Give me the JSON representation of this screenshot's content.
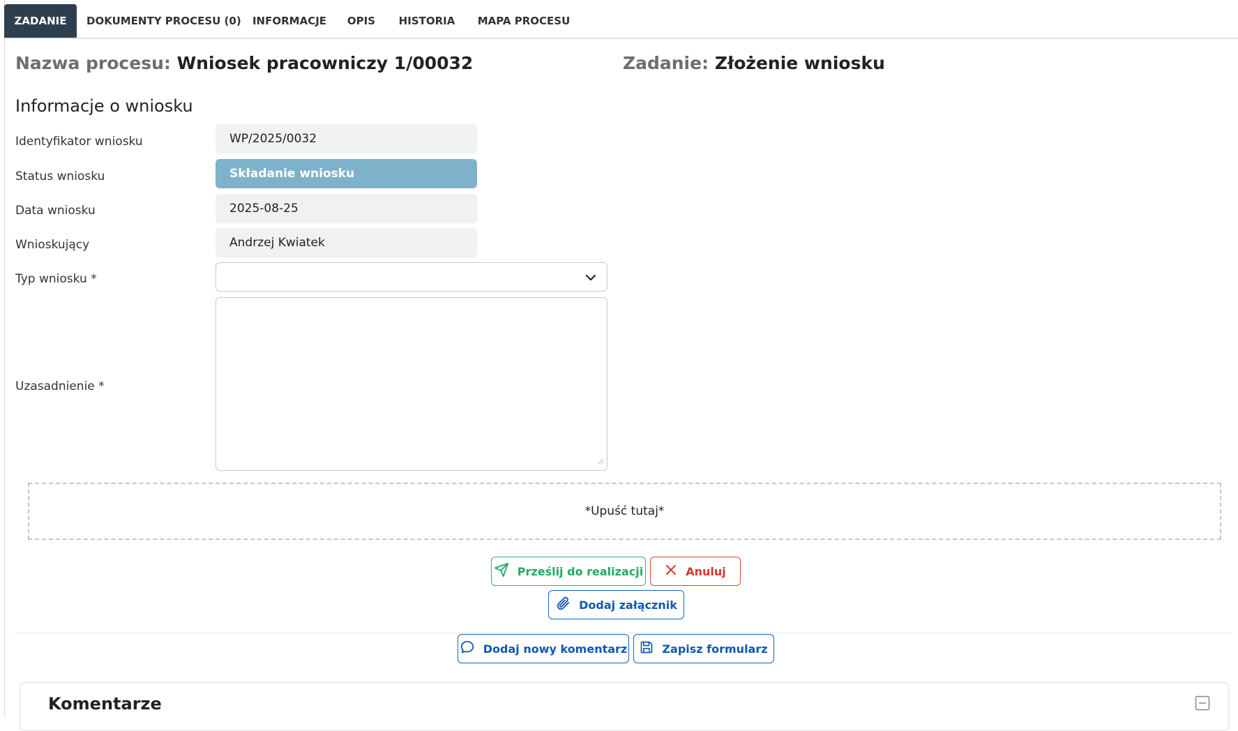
{
  "tabs": [
    {
      "label": "ZADANIE",
      "active": true
    },
    {
      "label": "DOKUMENTY PROCESU (0)",
      "active": false
    },
    {
      "label": "INFORMACJE",
      "active": false
    },
    {
      "label": "OPIS",
      "active": false
    },
    {
      "label": "HISTORIA",
      "active": false
    },
    {
      "label": "MAPA PROCESU",
      "active": false
    }
  ],
  "header": {
    "process_label": "Nazwa procesu:",
    "process_name": "Wniosek pracowniczy 1/00032",
    "task_label": "Zadanie:",
    "task_name": "Złożenie wniosku"
  },
  "section_title": "Informacje o wniosku",
  "form": {
    "id_label": "Identyfikator wniosku",
    "id_value": "WP/2025/0032",
    "status_label": "Status wniosku",
    "status_value": "Składanie wniosku",
    "date_label": "Data wniosku",
    "date_value": "2025-08-25",
    "applicant_label": "Wnioskujący",
    "applicant_value": "Andrzej Kwiatek",
    "type_label": "Typ wniosku *",
    "type_value": "",
    "justification_label": "Uzasadnienie *",
    "justification_value": ""
  },
  "dropzone_text": "*Upuść tutaj*",
  "buttons": {
    "submit": "Prześlij do realizacji",
    "cancel": "Anuluj",
    "attach": "Dodaj załącznik",
    "comment": "Dodaj nowy komentarz",
    "save": "Zapisz formularz"
  },
  "comments": {
    "title": "Komentarze"
  },
  "colors": {
    "tab_active": "#2d3e4f",
    "status_field": "#7eb2ca",
    "readonly_field": "#f0f2f2",
    "submit": "#2bb673",
    "cancel": "#e0453a",
    "primary": "#1565c0"
  },
  "icons": {
    "dropdown": "chevron-down-icon",
    "submit": "send-icon",
    "cancel": "close-icon",
    "attach": "paperclip-icon",
    "comment": "chat-bubble-icon",
    "save": "floppy-disk-icon",
    "collapse": "minus-square-icon"
  }
}
